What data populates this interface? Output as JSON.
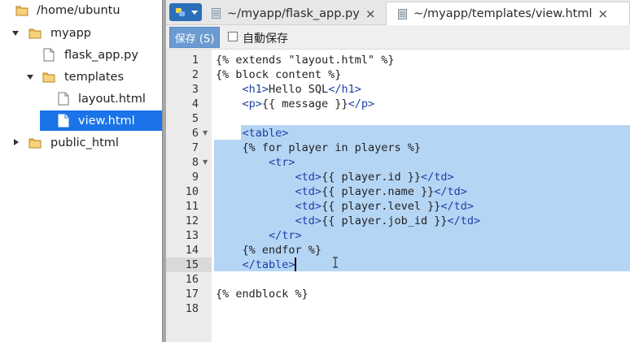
{
  "file_tree": {
    "root": {
      "label": "/home/ubuntu",
      "icon": "folder-icon"
    },
    "myapp": {
      "label": "myapp",
      "icon": "folder-icon"
    },
    "flask_app": {
      "label": "flask_app.py",
      "icon": "file-icon"
    },
    "templates": {
      "label": "templates",
      "icon": "folder-icon"
    },
    "layout": {
      "label": "layout.html",
      "icon": "file-icon"
    },
    "view": {
      "label": "view.html",
      "icon": "file-icon"
    },
    "public_html": {
      "label": "public_html",
      "icon": "folder-icon"
    }
  },
  "tabs": [
    {
      "label": "~/myapp/flask_app.py",
      "close": "×"
    },
    {
      "label": "~/myapp/templates/view.html",
      "close": "×"
    }
  ],
  "toolbar": {
    "save_label": "保存 (S)",
    "autosave_label": "自動保存"
  },
  "editor": {
    "lines": [
      {
        "n": "1",
        "parts": [
          [
            "tpl",
            "{% extends \"layout.html\" %}"
          ]
        ]
      },
      {
        "n": "2",
        "parts": [
          [
            "tpl",
            "{% block content %}"
          ]
        ]
      },
      {
        "n": "3",
        "parts": [
          [
            "txt",
            "    "
          ],
          [
            "tag",
            "<h1>"
          ],
          [
            "txt",
            "Hello SQL"
          ],
          [
            "tag",
            "</h1>"
          ]
        ]
      },
      {
        "n": "4",
        "parts": [
          [
            "txt",
            "    "
          ],
          [
            "tag",
            "<p>"
          ],
          [
            "tpl",
            "{{ message }}"
          ],
          [
            "tag",
            "</p>"
          ]
        ]
      },
      {
        "n": "5",
        "parts": []
      },
      {
        "n": "6",
        "parts": [
          [
            "txt",
            "    "
          ],
          [
            "tag",
            "<table>"
          ]
        ],
        "fold": true
      },
      {
        "n": "7",
        "parts": [
          [
            "txt",
            "    "
          ],
          [
            "tpl",
            "{% for player in players %}"
          ]
        ]
      },
      {
        "n": "8",
        "parts": [
          [
            "txt",
            "        "
          ],
          [
            "tag",
            "<tr>"
          ]
        ],
        "fold": true
      },
      {
        "n": "9",
        "parts": [
          [
            "txt",
            "            "
          ],
          [
            "tag",
            "<td>"
          ],
          [
            "tpl",
            "{{ player.id }}"
          ],
          [
            "tag",
            "</td>"
          ]
        ]
      },
      {
        "n": "10",
        "parts": [
          [
            "txt",
            "            "
          ],
          [
            "tag",
            "<td>"
          ],
          [
            "tpl",
            "{{ player.name }}"
          ],
          [
            "tag",
            "</td>"
          ]
        ]
      },
      {
        "n": "11",
        "parts": [
          [
            "txt",
            "            "
          ],
          [
            "tag",
            "<td>"
          ],
          [
            "tpl",
            "{{ player.level }}"
          ],
          [
            "tag",
            "</td>"
          ]
        ]
      },
      {
        "n": "12",
        "parts": [
          [
            "txt",
            "            "
          ],
          [
            "tag",
            "<td>"
          ],
          [
            "tpl",
            "{{ player.job_id }}"
          ],
          [
            "tag",
            "</td>"
          ]
        ]
      },
      {
        "n": "13",
        "parts": [
          [
            "txt",
            "        "
          ],
          [
            "tag",
            "</tr>"
          ]
        ]
      },
      {
        "n": "14",
        "parts": [
          [
            "txt",
            "    "
          ],
          [
            "tpl",
            "{% endfor %}"
          ]
        ]
      },
      {
        "n": "15",
        "parts": [
          [
            "txt",
            "    "
          ],
          [
            "tag",
            "</table>"
          ]
        ],
        "active": true
      },
      {
        "n": "16",
        "parts": []
      },
      {
        "n": "17",
        "parts": [
          [
            "tpl",
            "{% endblock %}"
          ]
        ]
      },
      {
        "n": "18",
        "parts": []
      }
    ]
  },
  "colors": {
    "selection": "#b5d5f5",
    "tree_selected": "#1a73e8",
    "save_button": "#6b9bd1",
    "tag": "#1d3fa8"
  }
}
